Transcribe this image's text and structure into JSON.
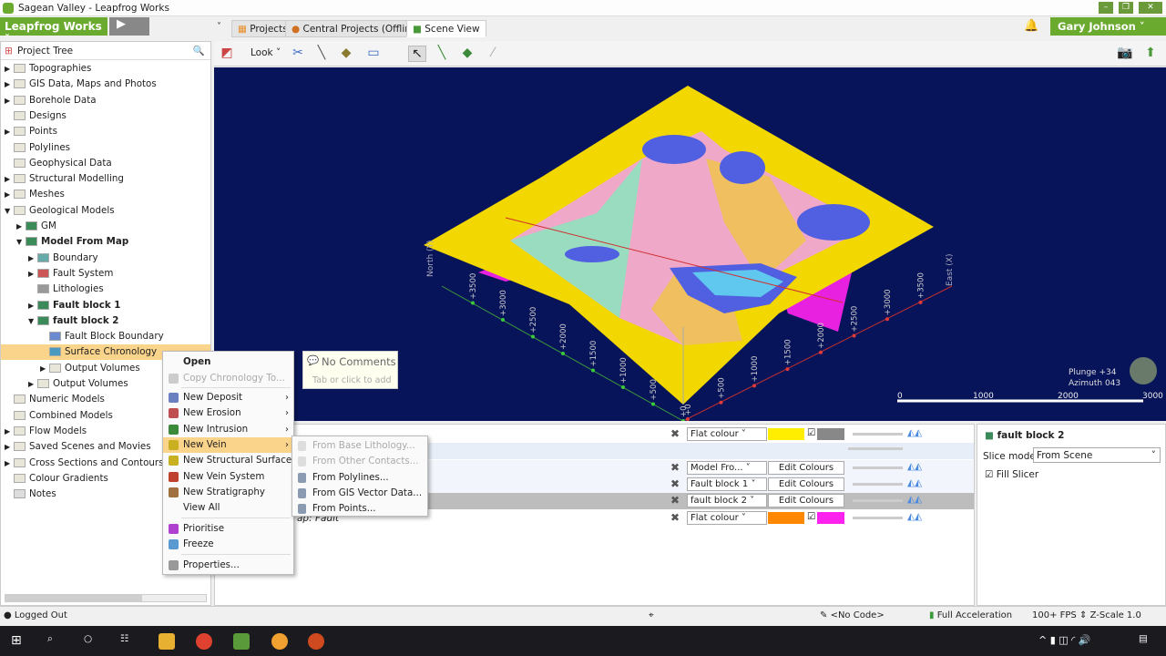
{
  "window": {
    "title": "Sagean Valley - Leapfrog Works"
  },
  "header": {
    "app_button": "Leapfrog Works",
    "user": "Gary Johnson",
    "tabs": [
      {
        "label": "Projects"
      },
      {
        "label": "Central Projects (Offline)"
      },
      {
        "label": "Scene View"
      }
    ]
  },
  "tree": {
    "title": "Project Tree",
    "items": [
      {
        "label": "Topographies"
      },
      {
        "label": "GIS Data, Maps and Photos"
      },
      {
        "label": "Borehole Data"
      },
      {
        "label": "Designs"
      },
      {
        "label": "Points"
      },
      {
        "label": "Polylines"
      },
      {
        "label": "Geophysical Data"
      },
      {
        "label": "Structural Modelling"
      },
      {
        "label": "Meshes"
      },
      {
        "label": "Geological Models"
      },
      {
        "label": "GM"
      },
      {
        "label": "Model From Map"
      },
      {
        "label": "Boundary"
      },
      {
        "label": "Fault System"
      },
      {
        "label": "Lithologies"
      },
      {
        "label": "Fault block 1"
      },
      {
        "label": "fault block 2"
      },
      {
        "label": "Fault Block Boundary"
      },
      {
        "label": "Surface Chronology"
      },
      {
        "label": "Output Volumes"
      },
      {
        "label": "Output Volumes"
      },
      {
        "label": "Numeric Models"
      },
      {
        "label": "Combined Models"
      },
      {
        "label": "Flow Models"
      },
      {
        "label": "Saved Scenes and Movies"
      },
      {
        "label": "Cross Sections and Contours"
      },
      {
        "label": "Colour Gradients"
      },
      {
        "label": "Notes"
      }
    ]
  },
  "toolbar": {
    "look": "Look"
  },
  "context_menu": {
    "items": [
      {
        "label": "Open"
      },
      {
        "label": "Copy Chronology To..."
      },
      {
        "label": "New Deposit"
      },
      {
        "label": "New Erosion"
      },
      {
        "label": "New Intrusion"
      },
      {
        "label": "New Vein"
      },
      {
        "label": "New Structural Surface"
      },
      {
        "label": "New Vein System"
      },
      {
        "label": "New Stratigraphy"
      },
      {
        "label": "View All"
      },
      {
        "label": "Prioritise"
      },
      {
        "label": "Freeze"
      },
      {
        "label": "Properties..."
      }
    ]
  },
  "submenu": {
    "items": [
      {
        "label": "From Base Lithology..."
      },
      {
        "label": "From Other Contacts..."
      },
      {
        "label": "From Polylines..."
      },
      {
        "label": "From GIS Vector Data..."
      },
      {
        "label": "From Points..."
      }
    ]
  },
  "comments": {
    "title": "No Comments",
    "hint": "Tab or click to add"
  },
  "scene": {
    "north_label": "North (Y)",
    "east_label": "East (X)",
    "north_ticks": [
      "+0",
      "+500",
      "+1000",
      "+1500",
      "+2000",
      "+2500",
      "+3000",
      "+3500"
    ],
    "east_ticks": [
      "+0",
      "+500",
      "+1000",
      "+1500",
      "+2000",
      "+2500",
      "+3000",
      "+3500"
    ],
    "scale_ticks": [
      "0",
      "1000",
      "2000",
      "3000"
    ],
    "plunge": "Plunge +34",
    "azimuth": "Azimuth 043",
    "colors": {
      "background": "#08145a",
      "surface": "#f2d800",
      "magenta": "#e820e0"
    }
  },
  "shapes": {
    "rows": [
      {
        "mode": "Flat colour",
        "colour": "#ffee00",
        "colour2": "#888888",
        "label": ""
      },
      {
        "mode": "Model Fro...",
        "button": "Edit Colours",
        "label": ""
      },
      {
        "mode": "Fault block 1",
        "button": "Edit Colours",
        "label": ""
      },
      {
        "mode": "fault block 2",
        "button": "Edit Colours",
        "label": ""
      },
      {
        "mode": "Flat colour",
        "colour": "#ff8800",
        "colour2": "#ff22ee",
        "label": "ap: Fault"
      }
    ]
  },
  "properties": {
    "title": "fault block 2",
    "slice_mode_label": "Slice mode:",
    "slice_mode": "From Scene",
    "fill_slicer": "Fill Slicer"
  },
  "status": {
    "login": "Logged Out",
    "code": "<No Code>",
    "accel": "Full Acceleration",
    "fps": "100+ FPS",
    "zscale": "Z-Scale 1.0"
  }
}
